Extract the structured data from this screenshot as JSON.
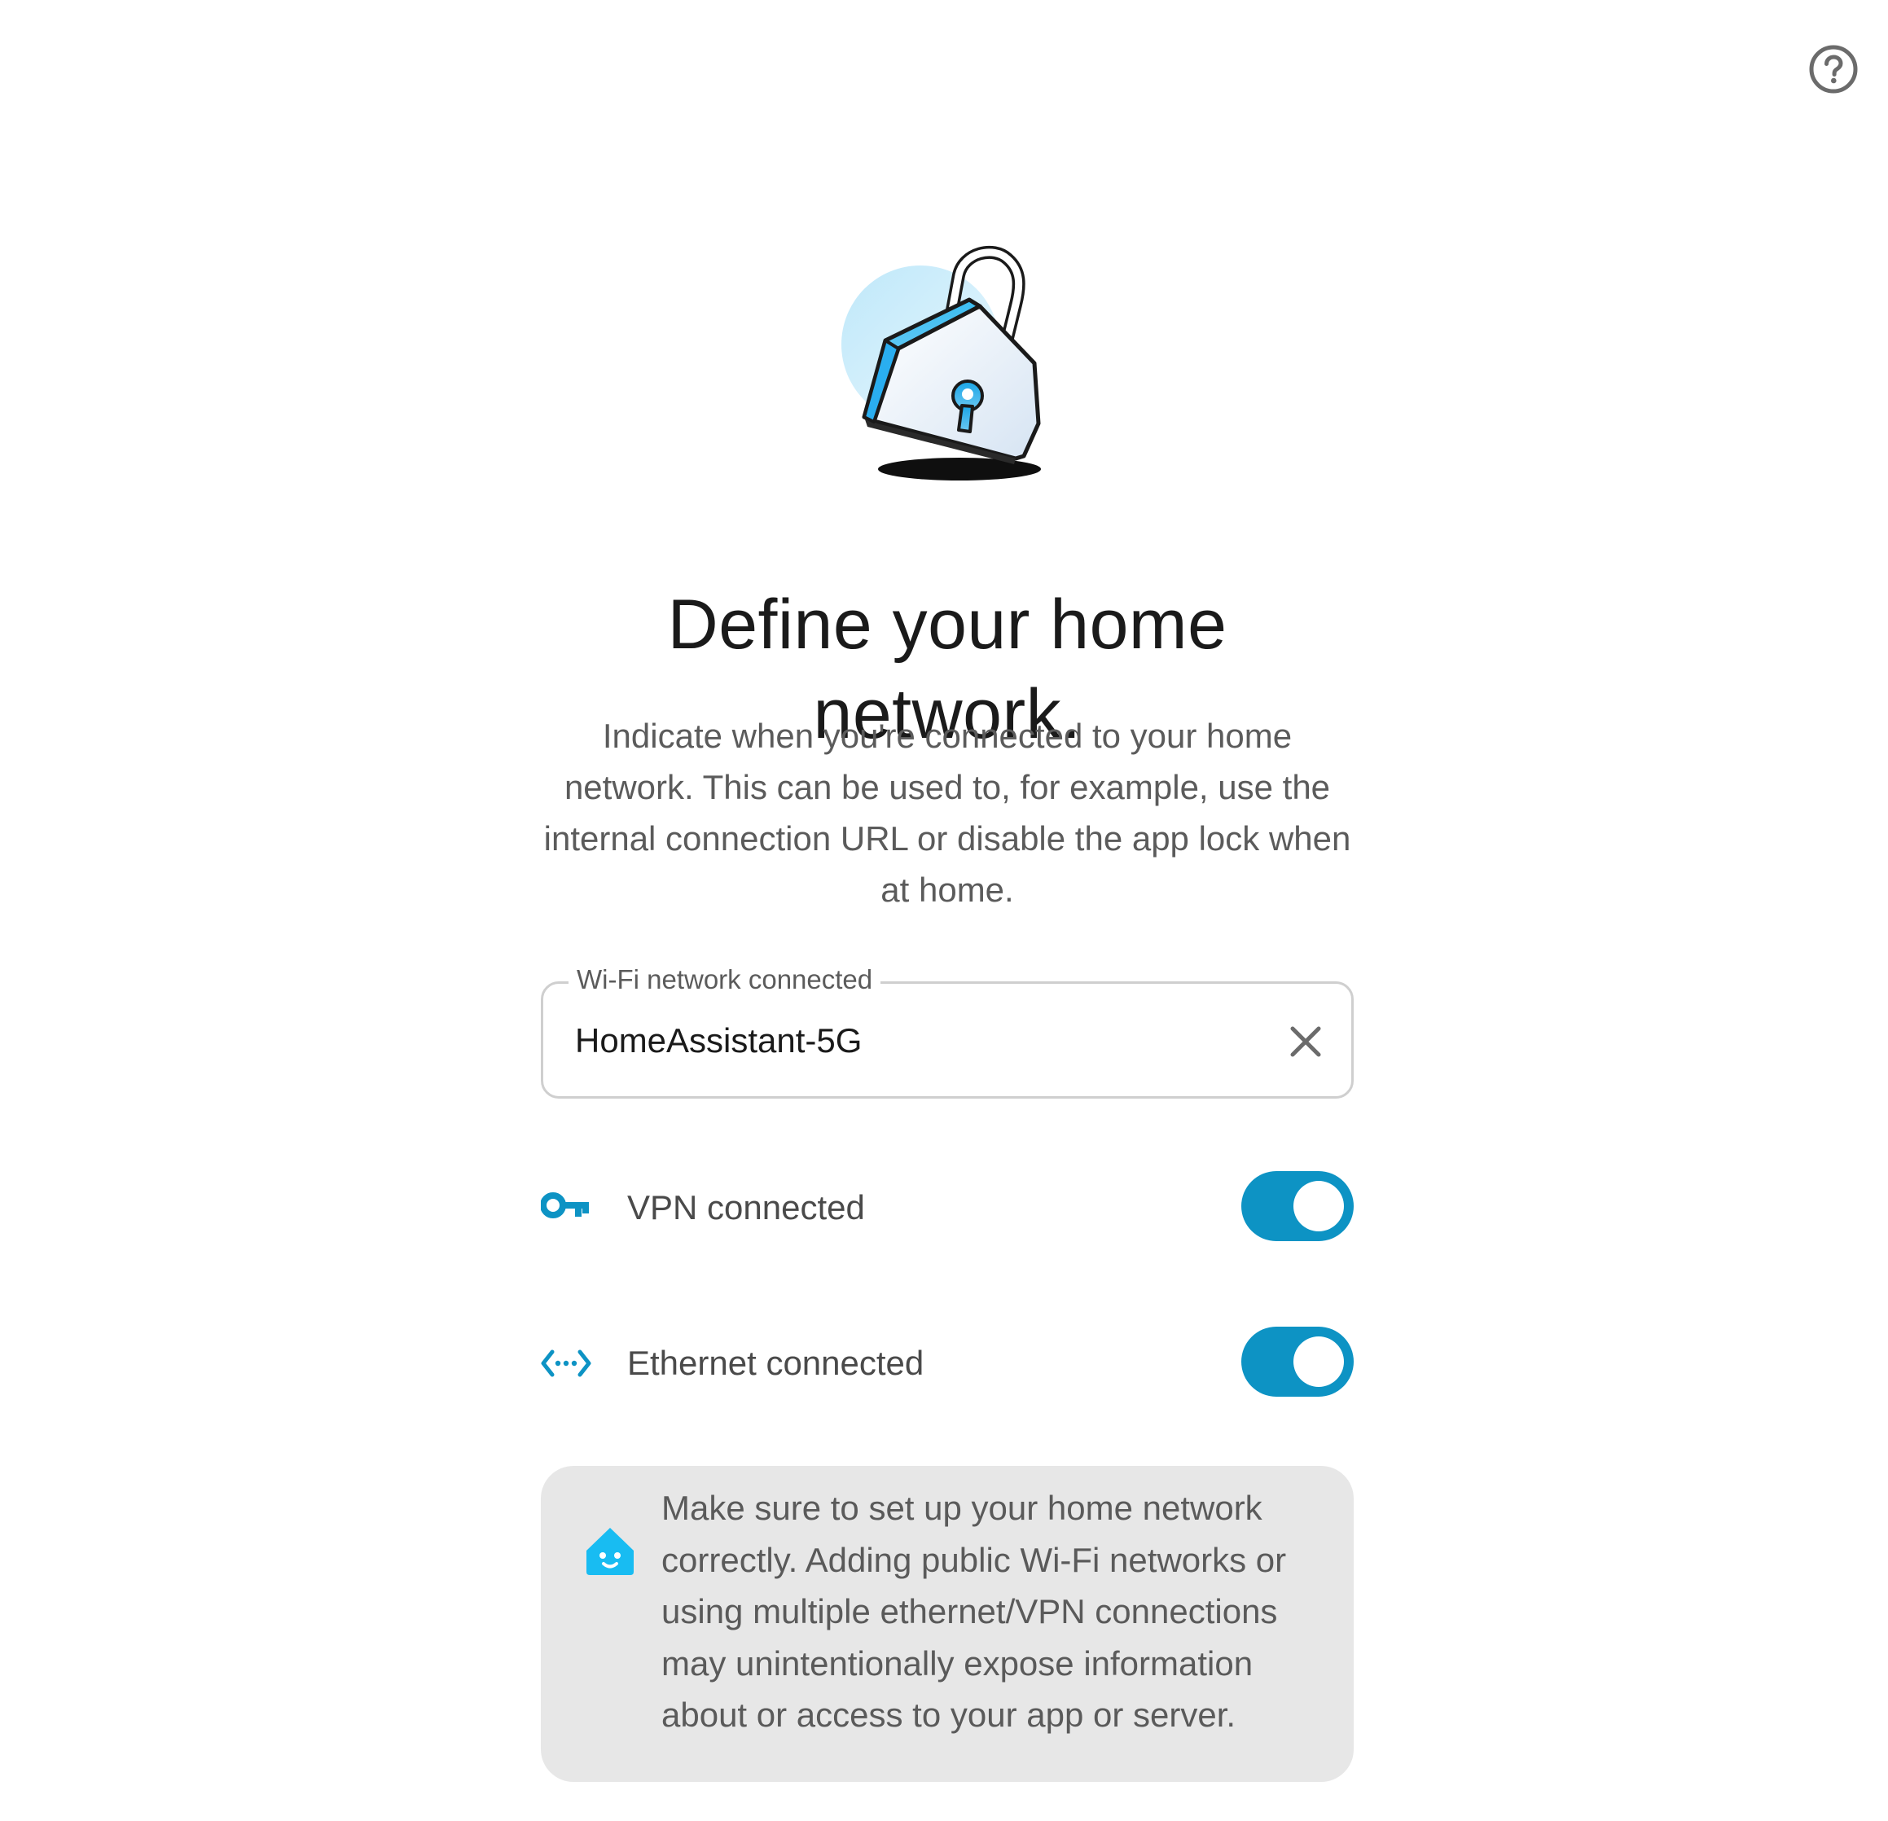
{
  "header": {
    "help_icon": "help-circle-icon"
  },
  "illustration": {
    "icon": "padlock-illustration",
    "colors": {
      "accent": "#0d93c4",
      "light_blue": "#cfeefb"
    }
  },
  "title": "Define your home network.",
  "description": "Indicate when you're connected to your home network. This can be used to, for example, use the internal connection URL or disable the app lock when at home.",
  "wifi": {
    "label": "Wi-Fi network connected",
    "value": "HomeAssistant-5G",
    "clear_icon": "close-icon"
  },
  "toggles": [
    {
      "label": "VPN connected",
      "icon": "key-icon",
      "checked": true
    },
    {
      "label": "Ethernet connected",
      "icon": "ethernet-icon",
      "checked": true
    }
  ],
  "notice": {
    "icon": "home-assistant-icon",
    "text": "Make sure to set up your home network correctly. Adding public Wi-Fi networks or using multiple ethernet/VPN connections may unintentionally expose information about or access to your app or server."
  },
  "colors": {
    "accent": "#0d93c4",
    "notice_bg": "#e7e7e7",
    "field_border": "#cfcfcf"
  }
}
